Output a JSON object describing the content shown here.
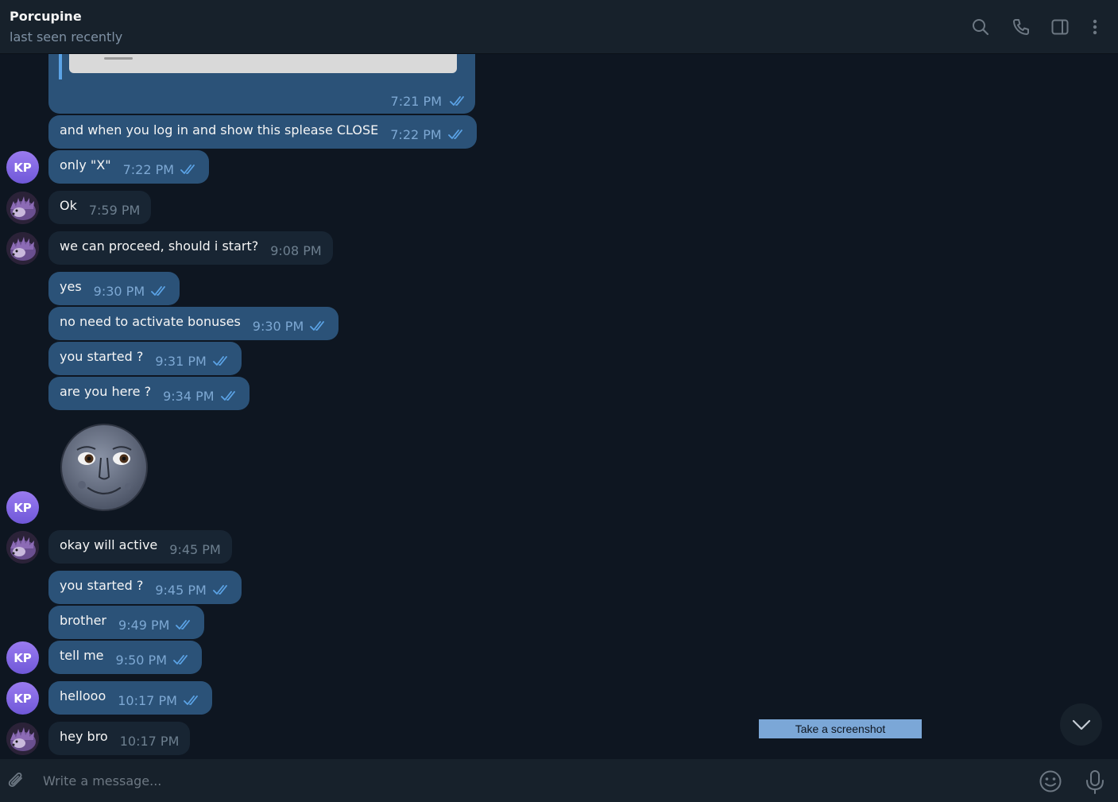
{
  "header": {
    "title": "Porcupine",
    "status": "last seen recently",
    "icons": [
      "search-icon",
      "phone-icon",
      "sidebar-toggle-icon",
      "more-vertical-icon"
    ]
  },
  "messages": [
    {
      "id": "m0",
      "direction": "out",
      "kind": "media",
      "time": "7:21 PM",
      "read": true
    },
    {
      "id": "m1",
      "direction": "out",
      "text": "and when you log in and show this splease CLOSE",
      "time": "7:22 PM",
      "read": true
    },
    {
      "id": "m2",
      "direction": "out",
      "text": "only \"X\"",
      "time": "7:22 PM",
      "read": true,
      "avatar": "KP"
    },
    {
      "id": "m3",
      "direction": "in",
      "text": "Ok",
      "time": "7:59 PM"
    },
    {
      "id": "m4",
      "direction": "in",
      "text": "we can proceed, should i start?",
      "time": "9:08 PM"
    },
    {
      "id": "m5",
      "direction": "out",
      "text": "yes",
      "time": "9:30 PM",
      "read": true
    },
    {
      "id": "m6",
      "direction": "out",
      "text": "no need to activate bonuses",
      "time": "9:30 PM",
      "read": true
    },
    {
      "id": "m7",
      "direction": "out",
      "text": "you started ?",
      "time": "9:31 PM",
      "read": true
    },
    {
      "id": "m8",
      "direction": "out",
      "text": "are you here ?",
      "time": "9:34 PM",
      "read": true
    },
    {
      "id": "m9",
      "direction": "out",
      "kind": "sticker",
      "sticker": "new-moon-face",
      "avatar": "KP"
    },
    {
      "id": "m10",
      "direction": "in",
      "text": "okay will active",
      "time": "9:45 PM"
    },
    {
      "id": "m11",
      "direction": "out",
      "text": "you started ?",
      "time": "9:45 PM",
      "read": true
    },
    {
      "id": "m12",
      "direction": "out",
      "text": "brother",
      "time": "9:49 PM",
      "read": true
    },
    {
      "id": "m13",
      "direction": "out",
      "text": "tell me",
      "time": "9:50 PM",
      "read": true,
      "avatar": "KP"
    },
    {
      "id": "m14",
      "direction": "out",
      "text": "hellooo",
      "time": "10:17 PM",
      "read": true,
      "avatar": "KP"
    },
    {
      "id": "m15",
      "direction": "in",
      "text": "hey bro",
      "time": "10:17 PM"
    }
  ],
  "avatars": {
    "me_initials": "KP"
  },
  "overlay": {
    "screenshot_label": "Take a screenshot"
  },
  "composer": {
    "placeholder": "Write a message..."
  },
  "colors": {
    "background": "#0e1621",
    "header": "#17212b",
    "outgoing": "#2b5278",
    "incoming": "#182533",
    "accent": "#5ba3e6",
    "avatar": "#8a6cf0"
  }
}
